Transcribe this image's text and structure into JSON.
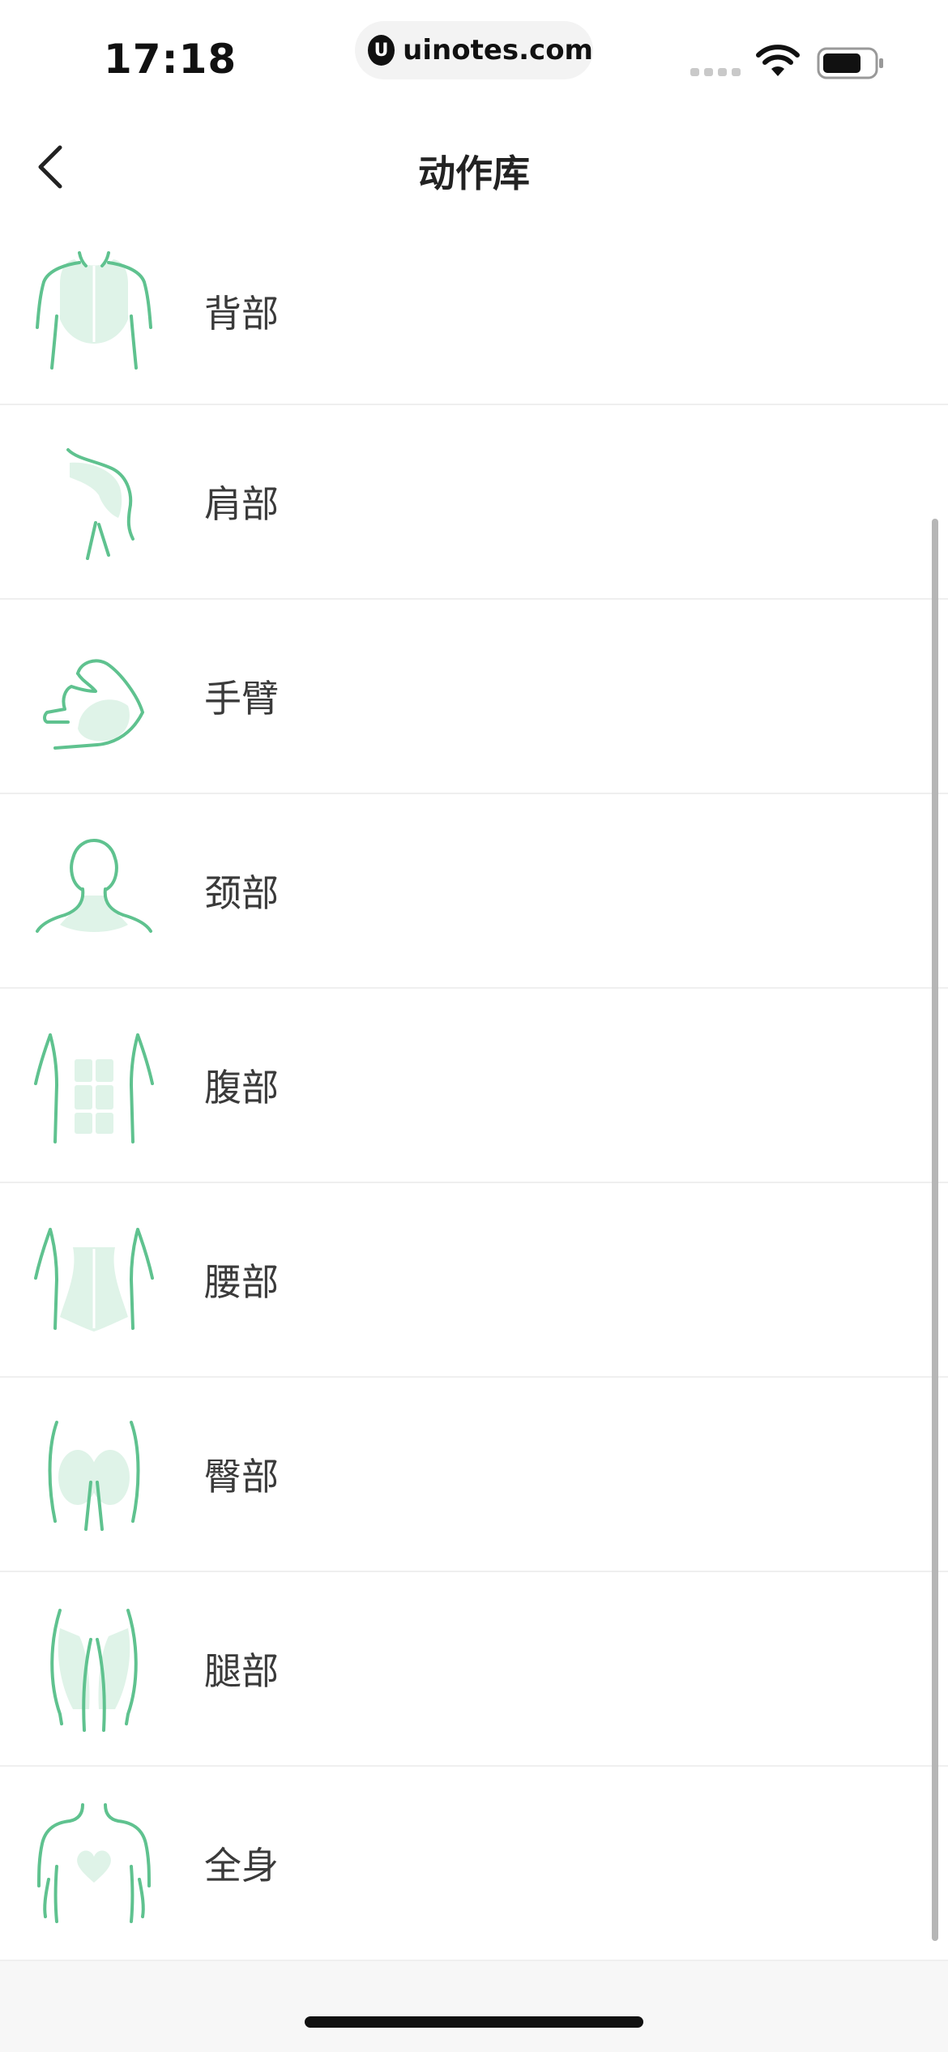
{
  "status_bar": {
    "time": "17:18",
    "url": "uinotes.com",
    "url_logo": "U"
  },
  "nav": {
    "title": "动作库",
    "back_icon": "chevron-left-icon"
  },
  "categories": [
    {
      "label": "背部",
      "icon": "back-muscle-icon"
    },
    {
      "label": "肩部",
      "icon": "shoulder-muscle-icon"
    },
    {
      "label": "手臂",
      "icon": "arm-muscle-icon"
    },
    {
      "label": "颈部",
      "icon": "neck-muscle-icon"
    },
    {
      "label": "腹部",
      "icon": "abdomen-muscle-icon"
    },
    {
      "label": "腰部",
      "icon": "waist-muscle-icon"
    },
    {
      "label": "臀部",
      "icon": "glute-muscle-icon"
    },
    {
      "label": "腿部",
      "icon": "leg-muscle-icon"
    },
    {
      "label": "全身",
      "icon": "full-body-icon"
    }
  ],
  "colors": {
    "accent_stroke": "#5fc28f",
    "accent_fill": "#dff3e8"
  }
}
